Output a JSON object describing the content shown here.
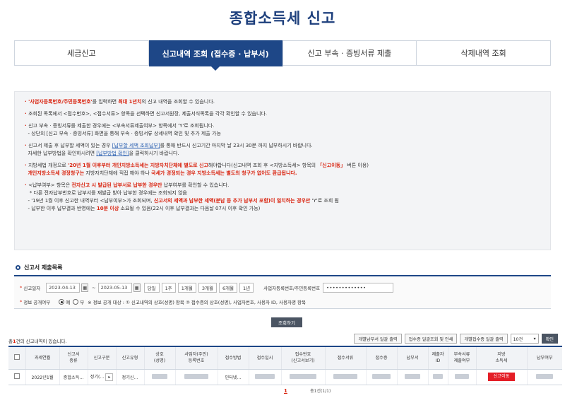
{
  "page_title": "종합소득세 신고",
  "tabs": [
    {
      "label": "세금신고"
    },
    {
      "label": "신고내역 조회 (접수증 · 납부서)"
    },
    {
      "label": "신고 부속 · 증빙서류 제출"
    },
    {
      "label": "삭제내역 조회"
    }
  ],
  "notice": {
    "l1a": "'사업자등록번호/주민등록번호'",
    "l1b": "를 입력하면 ",
    "l1c": "최대 1년치",
    "l1d": "의 신고 내역을 조회할 수 있습니다.",
    "l2": "조회된 목록에서 <접수번호>, <접수서류> 항목을 선택하면 신고서원장, 제출서식목록을 각각 확인할 수 있습니다.",
    "l3": "신고 부속 · 증빙서류를 제출한 경우에는 <부속서류제출여부> 항목에서 'Y'로 조회됩니다.",
    "l4": "- 상단의 [신고 부속 · 증빙서류] 화면을 통해 부속 · 증빙서류 상세내역 확인 및 추가 제출 가능",
    "l5a": "신고서 제출 후 납부할 세액이 있는 경우 ",
    "l5b": "[납부할 세액 조회납부]",
    "l5c": "를 통해 반드시 신고기간 마지막 날 23시 30분 까지 납부하시기 바랍니다.",
    "l6a": "자세한 납부방법을 확인하시려면 ",
    "l6b": "[납부방법 확인]",
    "l6c": "을 클릭하시기 바랍니다.",
    "l7a": "지방세법 개정으로 ",
    "l7b": "'20년 1월 이후부터 개인지방소득세는 지방자치단체에 별도로 신고",
    "l7c": "해야합니다(신고내역 조회 후 <지방소득세> 항목의 ",
    "l7d": "「신고이동」",
    "l7e": " 버튼 이용)",
    "l8a": "개인지방소득세 경정청구는",
    "l8b": " 지방자치단체에 직접 해야 하나 ",
    "l8c": "국세가 경정되는 경우 지방소득세는 별도의 청구가 없어도 환급됩니다.",
    "l9a": "<납부여부> 항목은 ",
    "l9b": "전자신고 시 발급된 납부서로 납부한 경우만",
    "l9c": " 납부여부를 확인할 수 있습니다.",
    "l10": "* 다른 전자납부번호로 납부서를 재발급 받아 납부한 경우에는 조회되지 않음",
    "l11a": "- '19년 1월 이후 신고한 내역부터 <납부여부>가 조회되며, ",
    "l11b": "신고서의 세액과 납부한 세액(분납 등 추가 납부서 포함)이 일치하는 경우만",
    "l11c": " 'Y'로 조회 됨",
    "l12a": "- 납부한 이후 납부결과 반영에는 ",
    "l12b": "10분 이상",
    "l12c": " 소요될 수 있음(22시 이후 납부결과는 다음날 07시 이후 확인 가능)"
  },
  "section_title": "신고서 제출목록",
  "search": {
    "date_label": "신고일자",
    "date_from": "2023-04-13",
    "date_to": "2023-05-13",
    "periods": [
      "당일",
      "1주",
      "1개월",
      "3개월",
      "6개월",
      "1년"
    ],
    "id_label": "사업자등록번호/주민등록번호",
    "id_value": "•••••••••••••",
    "disclose_label": "정보 공개여부",
    "yes": "예",
    "no": "부",
    "disclose_note": "※ 정보 공개 대상 : ① 신고내역의 상호(성명) 항목 ② 접수증의 상호(성명), 사업자번호, 사용자 ID, 사용자명 항목",
    "query_label": "조회하기"
  },
  "result": {
    "count_prefix": "총",
    "count": "1",
    "count_suffix": "건의 신고내역이 있습니다.",
    "btn_bulk_pay": "개별납부서 일괄 출력",
    "btn_receipt": "접수증 일괄조회 및 인쇄",
    "btn_individual": "개별접수증 일괄 출력",
    "page_size": "10건",
    "btn_confirm": "확인"
  },
  "table": {
    "headers": [
      "과세연월",
      "신고서\n종류",
      "신고구분",
      "신고유형",
      "상호\n(성명)",
      "사업자(주민)\n등록번호",
      "접수방법",
      "접수일시",
      "접수번호\n(신고서보기)",
      "접수서류",
      "접수증",
      "납부서",
      "제출자\nID",
      "부속서류\n제출여부",
      "지방\n소득세",
      "납부여부"
    ],
    "row": {
      "period": "2022년1월",
      "kind": "종합소득...",
      "type": "정기(...",
      "category": "정기신...",
      "method": "인터넷...",
      "move_btn": "신고이동"
    }
  },
  "pager": {
    "page": "1",
    "info": "총1건(1/1)"
  },
  "colors": {
    "primary": "#1e4787",
    "accent_red": "#d9230f",
    "title": "#1d3f7c"
  }
}
